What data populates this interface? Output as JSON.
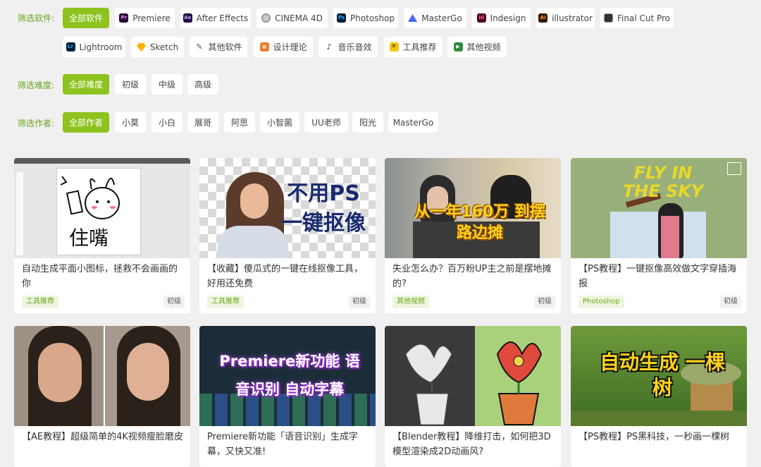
{
  "filters": {
    "software": {
      "label": "筛选软件:",
      "items": [
        "全部软件",
        "Premiere",
        "After Effects",
        "CINEMA 4D",
        "Photoshop",
        "MasterGo",
        "Indesign",
        "illustrator",
        "Final Cut Pro",
        "Lightroom",
        "Sketch",
        "其他软件",
        "设计理论",
        "音乐音效",
        "工具推荐",
        "其他视频"
      ],
      "icons": [
        "",
        "premiere-icon",
        "after-effects-icon",
        "cinema4d-icon",
        "photoshop-icon",
        "mastergo-icon",
        "indesign-icon",
        "illustrator-icon",
        "final-cut-pro-icon",
        "lightroom-icon",
        "sketch-icon",
        "other-software-icon",
        "design-theory-icon",
        "music-icon",
        "tools-icon",
        "play-icon"
      ]
    },
    "difficulty": {
      "label": "筛选难度:",
      "items": [
        "全部难度",
        "初级",
        "中级",
        "高级"
      ]
    },
    "author": {
      "label": "筛选作者:",
      "items": [
        "全部作者",
        "小莫",
        "小白",
        "展哥",
        "阿思",
        "小智菌",
        "UU老师",
        "阳光",
        "MasterGo"
      ]
    }
  },
  "icon_text": {
    "pr": "Pr",
    "ae": "Ae",
    "ps": "Ps",
    "id": "Id",
    "ai": "Ai",
    "lr": "Lr"
  },
  "cards": [
    {
      "title": "自动生成平面小图标，拯救不会画画的你",
      "tag": "工具推荐",
      "level": "初级",
      "thumb_text": "住嘴"
    },
    {
      "title": "【收藏】傻瓜式的一键在线抠像工具，好用还免费",
      "tag": "工具推荐",
      "level": "初级",
      "thumb_text": "不用PS 一键抠像"
    },
    {
      "title": "失业怎么办？百万粉UP主之前是摆地摊的?",
      "tag": "其他视频",
      "level": "初级",
      "thumb_text": "从一年160万 到摆路边摊"
    },
    {
      "title": "【PS教程】一键抠像高效做文字穿插海报",
      "tag": "Photoshop",
      "level": "初级",
      "thumb_text": "FLY IN THE SKY"
    },
    {
      "title": "【AE教程】超级简单的4K视频瘦脸磨皮",
      "tag": "",
      "level": ""
    },
    {
      "title": "Premiere新功能「语音识别」生成字幕，又快又准!",
      "tag": "",
      "level": "",
      "thumb_text": "Premiere新功能 语音识别 自动字幕"
    },
    {
      "title": "【Blender教程】降维打击，如何把3D模型渲染成2D动画风?",
      "tag": "",
      "level": ""
    },
    {
      "title": "【PS教程】PS黑科技，一秒画一棵树",
      "tag": "",
      "level": "",
      "thumb_text": "自动生成 一棵树"
    }
  ],
  "colors": {
    "accent": "#8ec31f",
    "label": "#6aa51d"
  }
}
